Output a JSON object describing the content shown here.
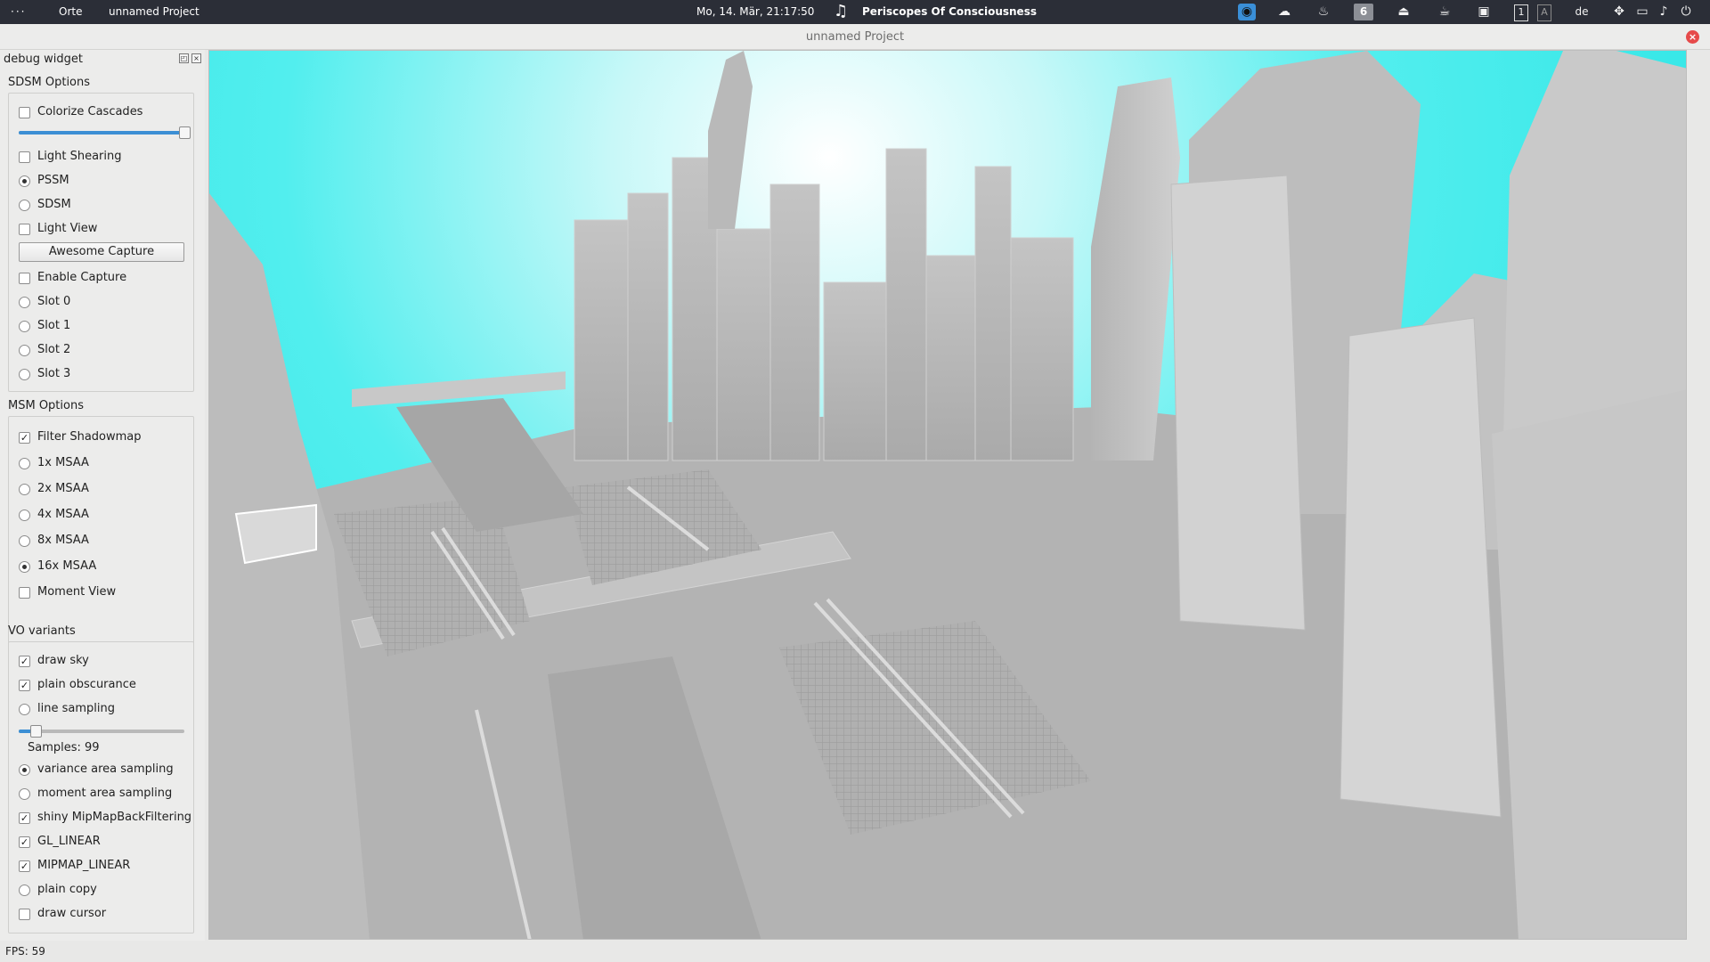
{
  "top_panel": {
    "dots": "···",
    "places": "Orte",
    "app_name": "unnamed Project",
    "clock": "Mo, 14. Mär, 21:17:50",
    "music_icon": "music-note-icon",
    "song": "Periscopes Of Consciousness",
    "workspace": "6",
    "keyboard_layout": "de",
    "tray_icons": [
      "spotify-icon",
      "weather-icon",
      "bulb-icon",
      "workspace-indicator",
      "eject-icon",
      "coffee-icon",
      "clipboard-icon",
      "keyboard-1-icon",
      "keyboard-a-icon",
      "network-icon",
      "display-icon",
      "volume-icon",
      "power-icon"
    ]
  },
  "window": {
    "title": "unnamed Project",
    "close_glyph": "×"
  },
  "dock": {
    "title": "debug widget",
    "float_glyph": "◰",
    "close_glyph": "×",
    "sdsm": {
      "label": "SDSM Options",
      "colorize": "Colorize Cascades",
      "light_shearing": "Light Shearing",
      "pssm": "PSSM",
      "sdsm": "SDSM",
      "light_view": "Light View",
      "awesome_capture": "Awesome Capture",
      "enable_capture": "Enable Capture",
      "slot0": "Slot 0",
      "slot1": "Slot 1",
      "slot2": "Slot 2",
      "slot3": "Slot 3",
      "cascade_slider_value": 1.0
    },
    "msm": {
      "label": "MSM Options",
      "filter": "Filter Shadowmap",
      "msaa1": "1x MSAA",
      "msaa2": "2x MSAA",
      "msaa4": "4x MSAA",
      "msaa8": "8x MSAA",
      "msaa16": "16x MSAA",
      "moment_view": "Moment View"
    },
    "vo": {
      "label": "VO variants",
      "draw_sky": "draw sky",
      "plain_obscurance": "plain obscurance",
      "line_sampling": "line sampling",
      "samples_label": "Samples: 99",
      "samples_slider_value": 0.1,
      "variance": "variance area sampling",
      "moment": "moment area sampling",
      "shiny": "shiny MipMapBackFiltering",
      "gl_linear": "GL_LINEAR",
      "mipmap_linear": "MIPMAP_LINEAR",
      "plain_copy": "plain copy",
      "draw_cursor": "draw cursor"
    }
  },
  "status": {
    "fps": "FPS: 59"
  },
  "colors": {
    "sky": "#39e8e8",
    "buildings": "#b6b6b6",
    "accent": "#3c8fd4",
    "panel_bg": "#2b2e37"
  }
}
